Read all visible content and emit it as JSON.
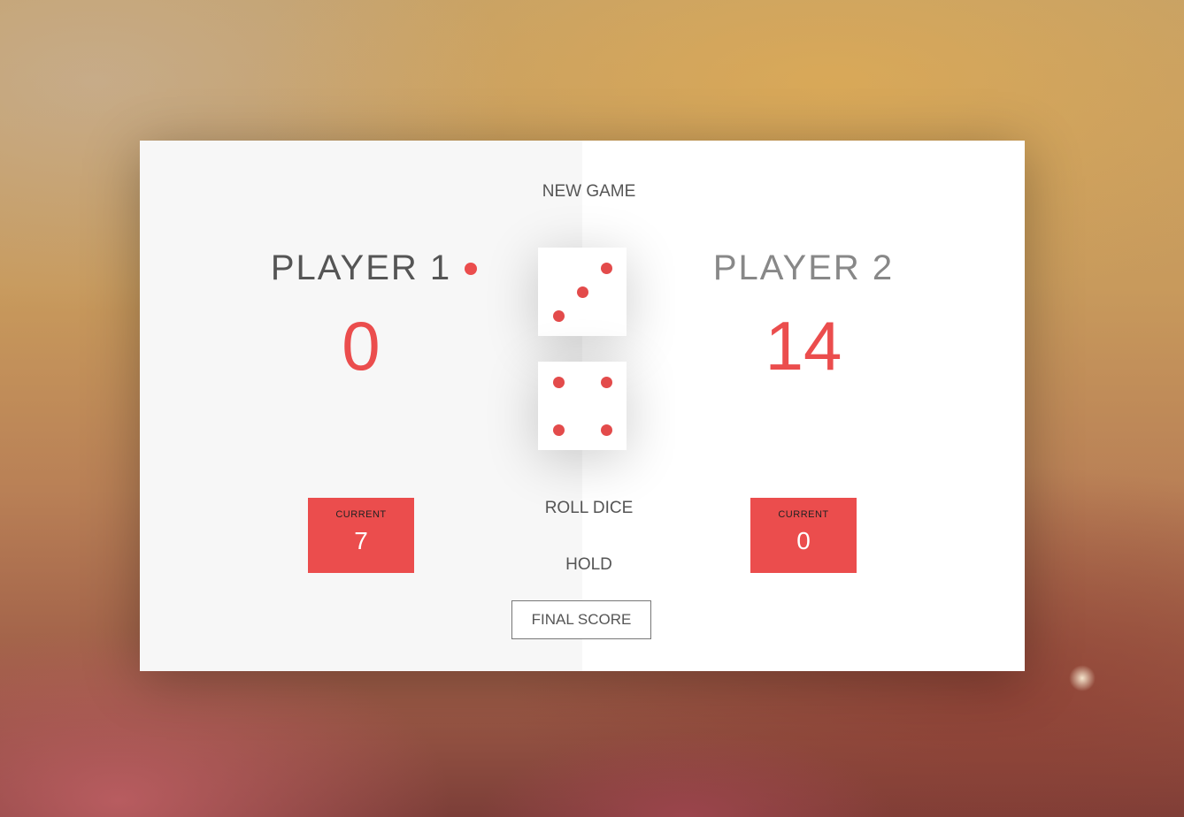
{
  "buttons": {
    "new_game": "NEW GAME",
    "roll_dice": "ROLL DICE",
    "hold": "HOLD"
  },
  "final_score": {
    "placeholder": "FINAL SCORE",
    "value": ""
  },
  "players": [
    {
      "name": "PLAYER 1",
      "score": "0",
      "current_label": "CURRENT",
      "current_score": "7",
      "active": true
    },
    {
      "name": "PLAYER 2",
      "score": "14",
      "current_label": "CURRENT",
      "current_score": "0",
      "active": false
    }
  ],
  "dice": [
    {
      "value": 3
    },
    {
      "value": 4
    }
  ],
  "colors": {
    "accent": "#EB4D4D",
    "panel_left": "#f7f7f7",
    "panel_right": "#ffffff",
    "text": "#555555"
  }
}
